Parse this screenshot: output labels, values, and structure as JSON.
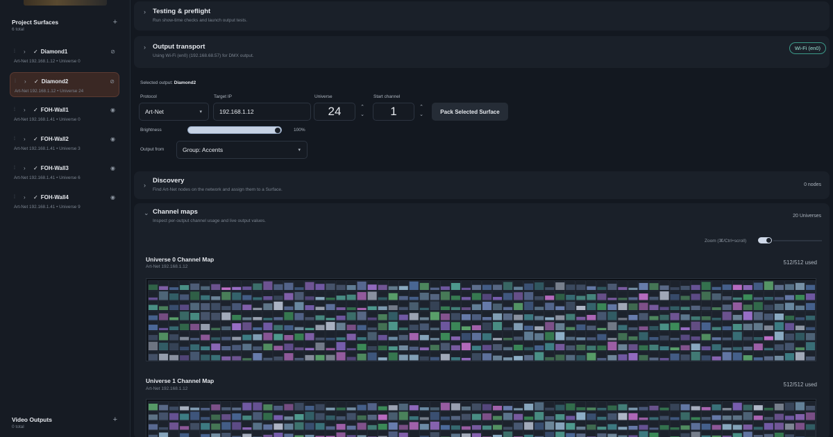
{
  "sidebar": {
    "surfaces_title": "Project Surfaces",
    "surfaces_sub": "6 total",
    "add_icon": "plus-icon",
    "items": [
      {
        "name": "Diamond1",
        "meta": "Art-Net 192.168.1.12 • Universe 0",
        "visibility": "eye-off-icon",
        "selected": false
      },
      {
        "name": "Diamond2",
        "meta": "Art-Net 192.168.1.12 • Universe 24",
        "visibility": "eye-off-icon",
        "selected": true
      },
      {
        "name": "FOH-Wall1",
        "meta": "Art-Net 192.168.1.41 • Universe 0",
        "visibility": "eye-icon",
        "selected": false
      },
      {
        "name": "FOH-Wall2",
        "meta": "Art-Net 192.168.1.41 • Universe 3",
        "visibility": "eye-icon",
        "selected": false
      },
      {
        "name": "FOH-Wall3",
        "meta": "Art-Net 192.168.1.41 • Universe 6",
        "visibility": "eye-icon",
        "selected": false
      },
      {
        "name": "FOH-Wall4",
        "meta": "Art-Net 192.168.1.41 • Universe 9",
        "visibility": "eye-icon",
        "selected": false
      }
    ],
    "video_title": "Video Outputs",
    "video_sub": "0 total"
  },
  "testing": {
    "title": "Testing & preflight",
    "sub": "Run show-time checks and launch output tests."
  },
  "transport": {
    "title": "Output transport",
    "sub": "Using Wi-Fi (en0) (192.168.68.57) for DMX output.",
    "badge": "Wi-Fi (en0)",
    "selected_label": "Selected output:",
    "selected_value": "Diamond2",
    "protocol_label": "Protocol",
    "protocol_value": "Art-Net",
    "ip_label": "Target IP",
    "ip_value": "192.168.1.12",
    "universe_label": "Universe",
    "universe_value": "24",
    "channel_label": "Start channel",
    "channel_value": "1",
    "pack_button": "Pack Selected Surface",
    "brightness_label": "Brightness",
    "brightness_value": "100%",
    "brightness_level": 1.0,
    "output_from_label": "Output from",
    "output_from_value": "Group: Accents"
  },
  "discovery": {
    "title": "Discovery",
    "sub": "Find Art-Net nodes on the network and assign them to a Surface.",
    "badge": "0 nodes"
  },
  "channel_maps": {
    "title": "Channel maps",
    "sub": "Inspect per-output channel usage and live output values.",
    "badge": "20 Universes",
    "zoom_label": "Zoom (⌘/Ctrl+scroll)",
    "maps": [
      {
        "title": "Universe 0 Channel Map",
        "sub": "Art-Net 192.168.1.12",
        "used": "512/512 used"
      },
      {
        "title": "Universe 1 Channel Map",
        "sub": "Art-Net 192.168.1.12",
        "used": "512/512 used"
      }
    ]
  },
  "colors": {
    "accent": "#3c9b8a",
    "selected_bg": "#3a2824",
    "panel": "#1a2029"
  }
}
